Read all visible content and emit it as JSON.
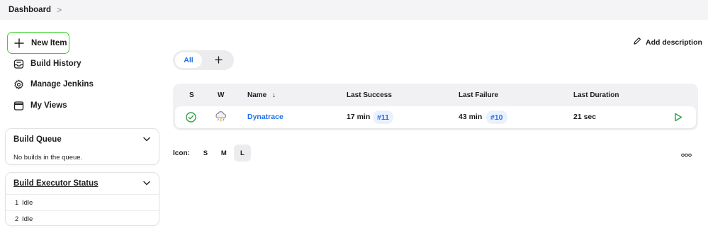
{
  "breadcrumb": {
    "dashboard": "Dashboard",
    "separator": ">"
  },
  "sidebar": {
    "items": [
      {
        "label": "New Item",
        "icon": "plus-icon"
      },
      {
        "label": "Build History",
        "icon": "inbox-icon"
      },
      {
        "label": "Manage Jenkins",
        "icon": "gear-icon"
      },
      {
        "label": "My Views",
        "icon": "window-icon"
      }
    ]
  },
  "build_queue": {
    "title": "Build Queue",
    "empty_text": "No builds in the queue."
  },
  "executor_status": {
    "title": "Build Executor Status",
    "executors": [
      {
        "num": "1",
        "state": "Idle"
      },
      {
        "num": "2",
        "state": "Idle"
      }
    ]
  },
  "actions": {
    "add_description": "Add description"
  },
  "view_tabs": {
    "all": "All",
    "add": "+"
  },
  "table": {
    "headers": {
      "s": "S",
      "w": "W",
      "name": "Name",
      "sort_arrow": "↓",
      "last_success": "Last Success",
      "last_failure": "Last Failure",
      "last_duration": "Last Duration"
    },
    "rows": [
      {
        "status": "success",
        "weather": "thunderstorm",
        "name": "Dynatrace",
        "last_success_time": "17 min",
        "last_success_build": "#11",
        "last_failure_time": "43 min",
        "last_failure_build": "#10",
        "last_duration": "21 sec"
      }
    ]
  },
  "icon_size": {
    "label": "Icon:",
    "options": [
      "S",
      "M",
      "L"
    ],
    "selected": "L"
  },
  "colors": {
    "accent": "#1f6feb",
    "success": "#2ea043",
    "highlight_border": "#3cd02a"
  }
}
